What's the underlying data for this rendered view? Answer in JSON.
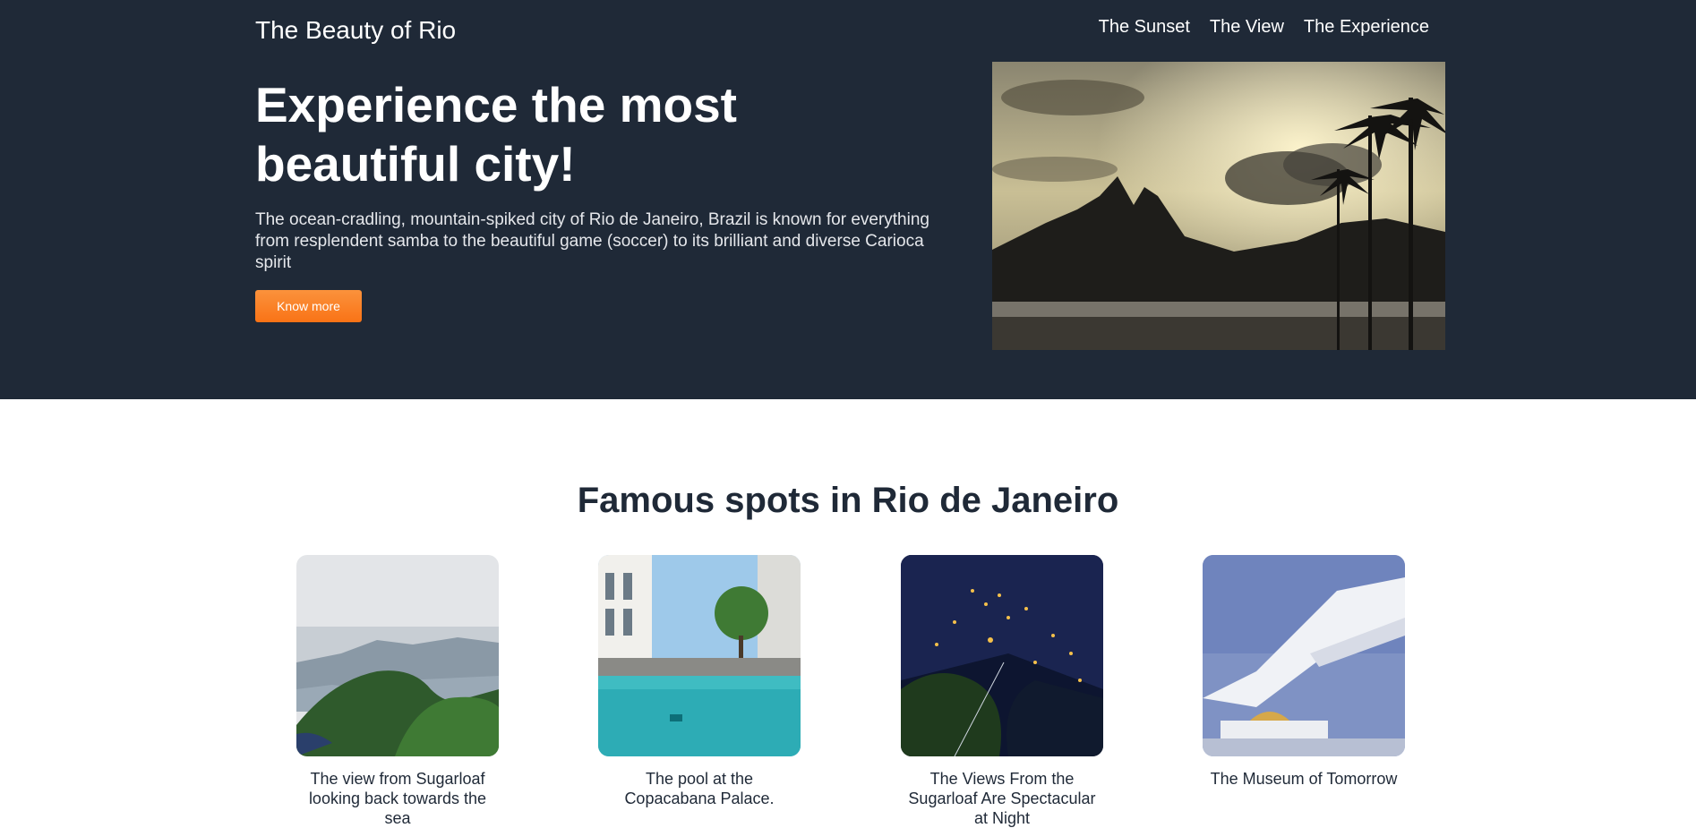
{
  "header": {
    "brand": "The Beauty of Rio",
    "nav": [
      "The Sunset",
      "The View",
      "The Experience"
    ]
  },
  "hero": {
    "headline": "Experience the most beautiful city!",
    "lede": "The ocean-cradling, mountain-spiked city of Rio de Janeiro, Brazil is known for everything from resplendent samba to the beautiful game (soccer) to its brilliant and diverse Carioca spirit",
    "cta_label": "Know more"
  },
  "spots": {
    "title": "Famous spots in Rio de Janeiro",
    "cards": [
      {
        "caption": "The view from Sugarloaf looking back towards the sea"
      },
      {
        "caption": "The pool at the Copacabana Palace."
      },
      {
        "caption": "The Views From the Sugarloaf Are Spectacular at Night"
      },
      {
        "caption": "The Museum of Tomorrow"
      }
    ]
  },
  "colors": {
    "hero_bg": "#1f2937",
    "accent": "#f97316",
    "text_dark": "#1f2937"
  }
}
